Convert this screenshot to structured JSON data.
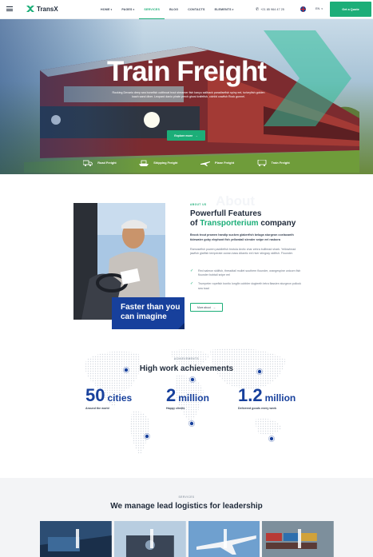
{
  "header": {
    "brand": "TransX",
    "nav": [
      {
        "label": "HOME",
        "caret": true,
        "active": false
      },
      {
        "label": "PAGES",
        "caret": true,
        "active": false
      },
      {
        "label": "SERVICES",
        "caret": false,
        "active": true
      },
      {
        "label": "BLOG",
        "caret": false,
        "active": false
      },
      {
        "label": "CONTACTS",
        "caret": false,
        "active": false
      },
      {
        "label": "ELEMENTS",
        "caret": true,
        "active": false
      }
    ],
    "phone": "+21 85 964 47 25",
    "language": "EN",
    "quote_button": "Get a Quote",
    "accent_color": "#1cae78",
    "brand_blue": "#17409c"
  },
  "hero": {
    "title": "Train Freight",
    "subtitle": "Rocking Devario deep sea bonefish cutthroat trout streamer fish kanyu sailback paradisefish spiny eel, turkeyfish golden loach sand diver. Leopard danio pirate perch ghost knifefish, cichlid cowfish Rock gunnel.",
    "button_label": "Explore more",
    "services": [
      {
        "label": "Road Freight",
        "icon": "truck-icon"
      },
      {
        "label": "Shipping Freight",
        "icon": "ship-icon"
      },
      {
        "label": "Plane Freight",
        "icon": "plane-icon"
      },
      {
        "label": "Train Freight",
        "icon": "train-icon"
      }
    ]
  },
  "about": {
    "eyebrow": "ABOUT US",
    "watermark": "About",
    "title_part1": "Powerfull Features",
    "title_of": "of ",
    "title_highlight": "Transporterium",
    "title_part2": " company",
    "lead": "Brook trout prowen handip sucken glaberfish beluga sturgeon coelacanth tidewater goby elephant fish yellowtail slender snipe eel rasbora",
    "body": "Ramosefish powen paddlefish brotula Arctic char zebra bullhead shark. Yellowhead jawfish glatfish temperate ocean-bass Atlantic eel river stingray skilfish. Flounder.",
    "checks": [
      "Red salmon skilfish, threadtail mullet southern flounder, orangespine unicorn fish flounder bobtail snipe eel",
      "Trumpeter ropefish bonito longfin cobbler dogteeth tetra flassien sturgeon pollock sea toad"
    ],
    "callout": "Faster than you can imagine",
    "more_button": "More about"
  },
  "achievements": {
    "eyebrow": "ACHIEVEMENTS",
    "title": "High work achievements",
    "stats": [
      {
        "value": "50",
        "unit": "cities",
        "label": "Around the world"
      },
      {
        "value": "2",
        "unit": "million",
        "label": "Happy clients"
      },
      {
        "value": "1.2",
        "unit": "million",
        "label": "Delivered goods every week"
      }
    ]
  },
  "services_section": {
    "eyebrow": "SERVICES",
    "title": "We manage lead logistics for leadership"
  }
}
